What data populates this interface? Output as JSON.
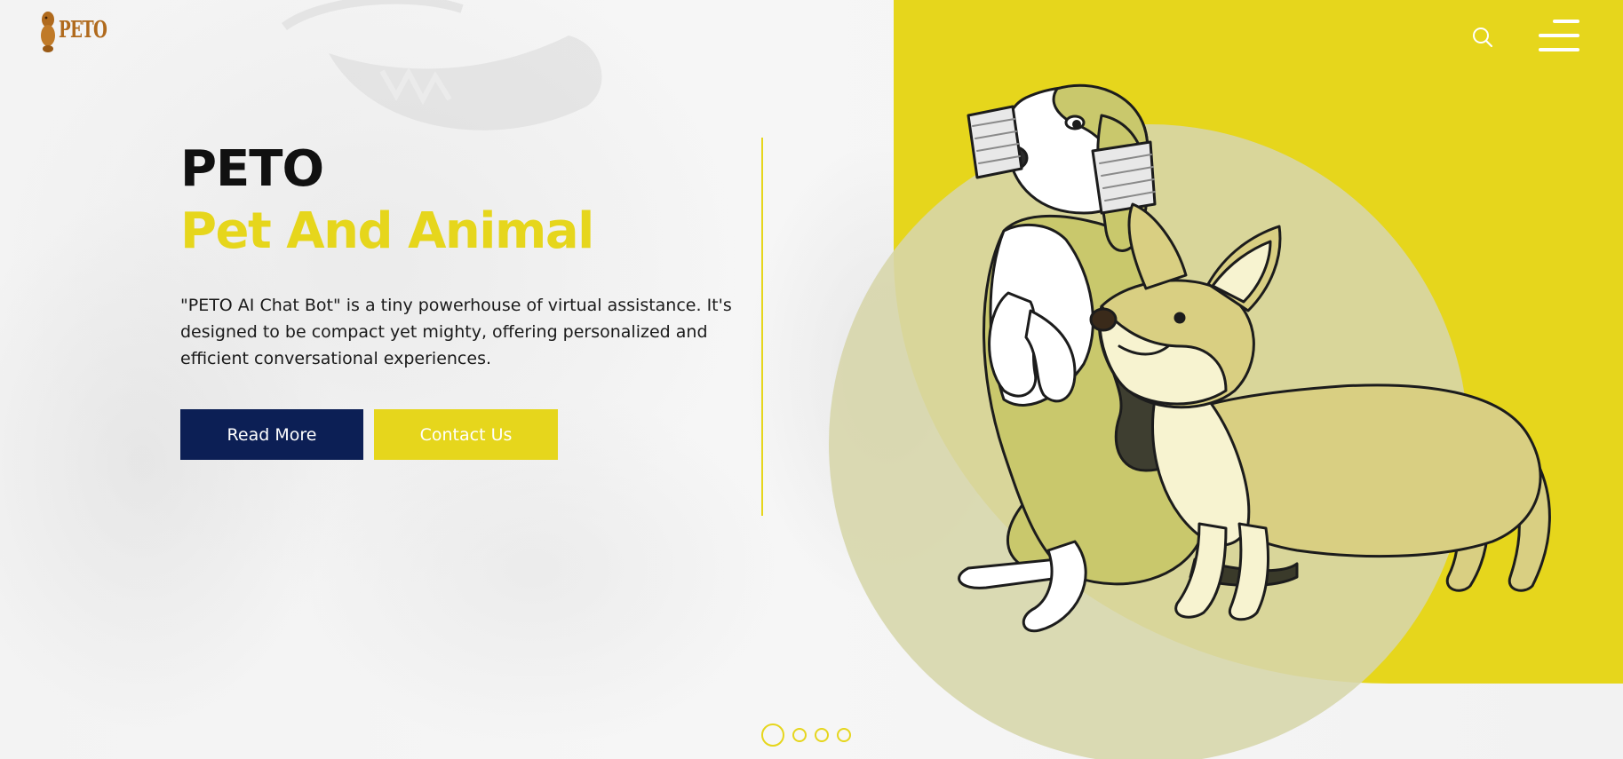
{
  "header": {
    "logo_text": "PETO",
    "search_icon": "search-icon",
    "menu_icon": "hamburger-menu-icon"
  },
  "hero": {
    "brand": "PETO",
    "subtitle": "Pet And Animal",
    "description": "\"PETO AI Chat Bot\" is a tiny powerhouse of virtual assistance. It's designed to be compact yet mighty, offering personalized and efficient conversational experiences.",
    "read_more_label": "Read More",
    "contact_label": "Contact Us"
  },
  "slider": {
    "active_index": 0,
    "count": 4
  },
  "colors": {
    "accent": "#e6d61c",
    "primary_button": "#0c1f55",
    "text": "#111111",
    "logo": "#b06a1d"
  }
}
